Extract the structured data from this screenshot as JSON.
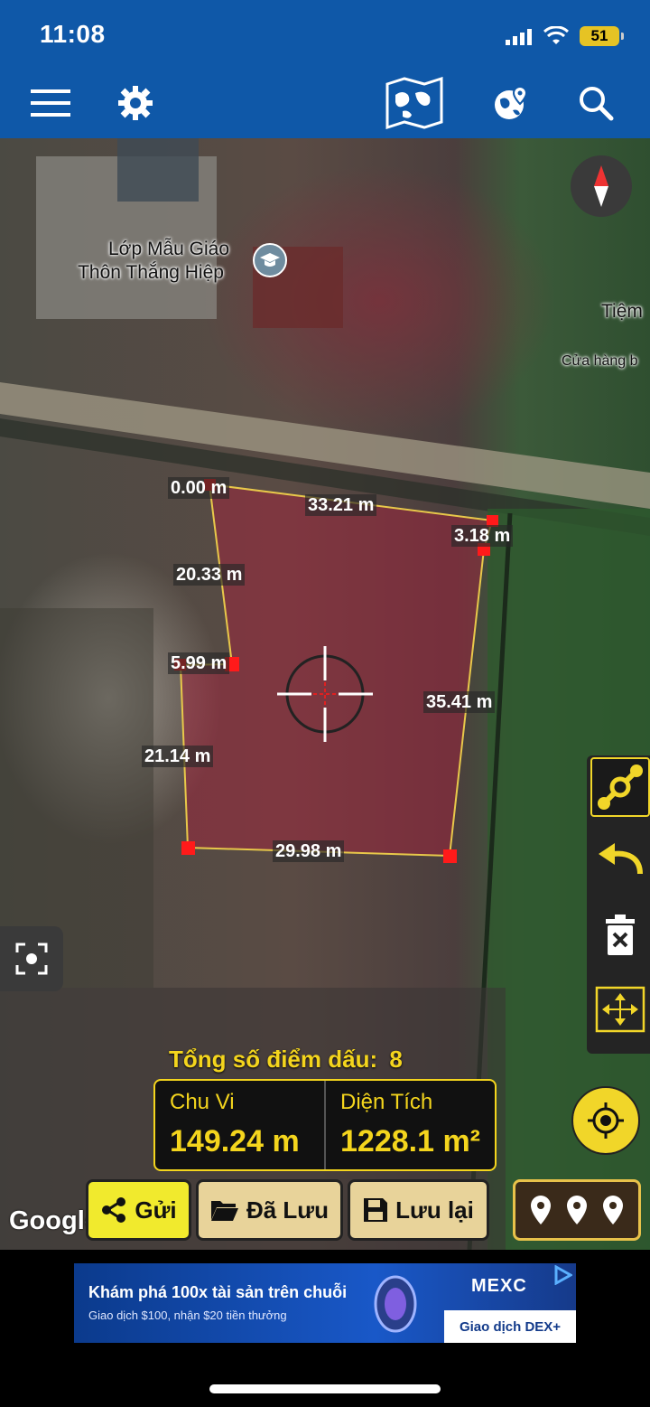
{
  "status_bar": {
    "time": "11:08",
    "battery": "51"
  },
  "header": {
    "icons": [
      "menu-icon",
      "gear-icon",
      "map-icon",
      "globe-pin-icon",
      "search-icon"
    ]
  },
  "map": {
    "places": [
      {
        "line1": "Lớp Mẫu Giáo",
        "line2": "Thôn Thắng Hiệp"
      },
      {
        "line1": "Tiệm",
        "line2": "Cửa hàng b"
      }
    ],
    "measurements": [
      "0.00 m",
      "33.21 m",
      "3.18 m",
      "20.33 m",
      "5.99 m",
      "35.41 m",
      "21.14 m",
      "29.98 m"
    ],
    "attribution": "Google"
  },
  "summary": {
    "point_count_label": "Tổng số điểm dấu:",
    "point_count": "8",
    "perimeter_label": "Chu Vi",
    "perimeter_value": "149.24 m",
    "area_label": "Diện Tích",
    "area_value": "1228.1 m²"
  },
  "actions": {
    "send": "Gửi",
    "saved": "Đã Lưu",
    "save": "Lưu lại"
  },
  "ad": {
    "title": "Khám phá 100x tài sản trên chuỗi",
    "subtitle": "Giao dịch $100, nhận $20 tiền thưởng",
    "brand": "MEXC",
    "cta": "Giao dịch DEX+"
  },
  "colors": {
    "header_bg": "#0f58a8",
    "accent_yellow": "#f4d51d",
    "polygon_fill": "#a0203a",
    "marker": "#ff0000"
  }
}
